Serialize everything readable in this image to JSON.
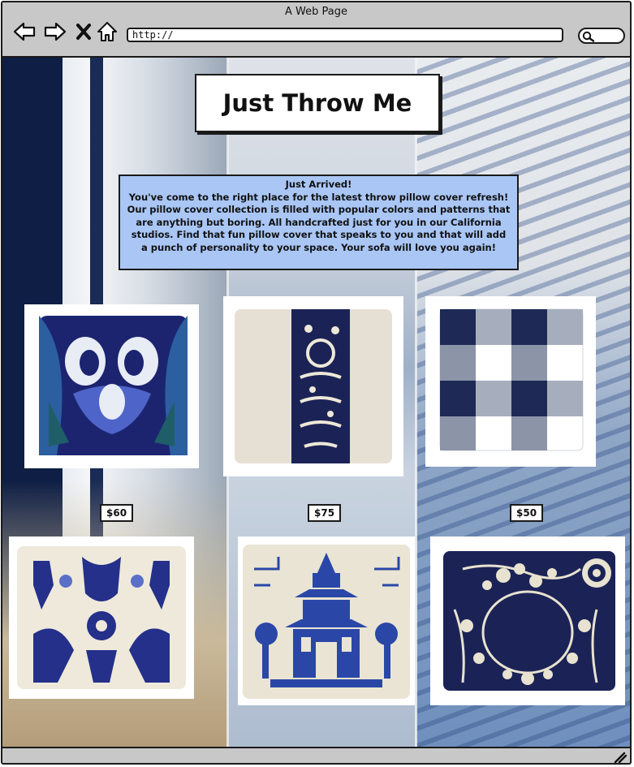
{
  "window": {
    "title": "A Web Page",
    "url": "http://"
  },
  "icons": {
    "back": "arrow-left-icon",
    "forward": "arrow-right-icon",
    "stop": "close-icon",
    "home": "home-icon",
    "search": "search-icon",
    "resize": "resize-grip-icon"
  },
  "site": {
    "title": "Just Throw Me",
    "intro": {
      "heading": "Just Arrived!",
      "body": "You've come to the right place for the latest throw pillow cover refresh! Our pillow cover collection is filled with popular colors and patterns that are anything but boring. All handcrafted just for you in our California studios. Find that fun pillow cover that speaks to you and that will add a punch of personality to your space. Your sofa will love you again!"
    }
  },
  "products": [
    {
      "pattern": "blue ikat pillow",
      "price": "$60"
    },
    {
      "pattern": "navy toile band pillow",
      "price": "$75"
    },
    {
      "pattern": "navy buffalo check pillow",
      "price": "$50"
    },
    {
      "pattern": "blue damask ikat pillow"
    },
    {
      "pattern": "blue pagoda chinoiserie pillow"
    },
    {
      "pattern": "navy floral toile pillow"
    }
  ],
  "colors": {
    "intro_bg": "#a9c6f5",
    "chrome": "#c8c8c8",
    "navy": "#1b2356",
    "cream": "#f1ecdd"
  }
}
